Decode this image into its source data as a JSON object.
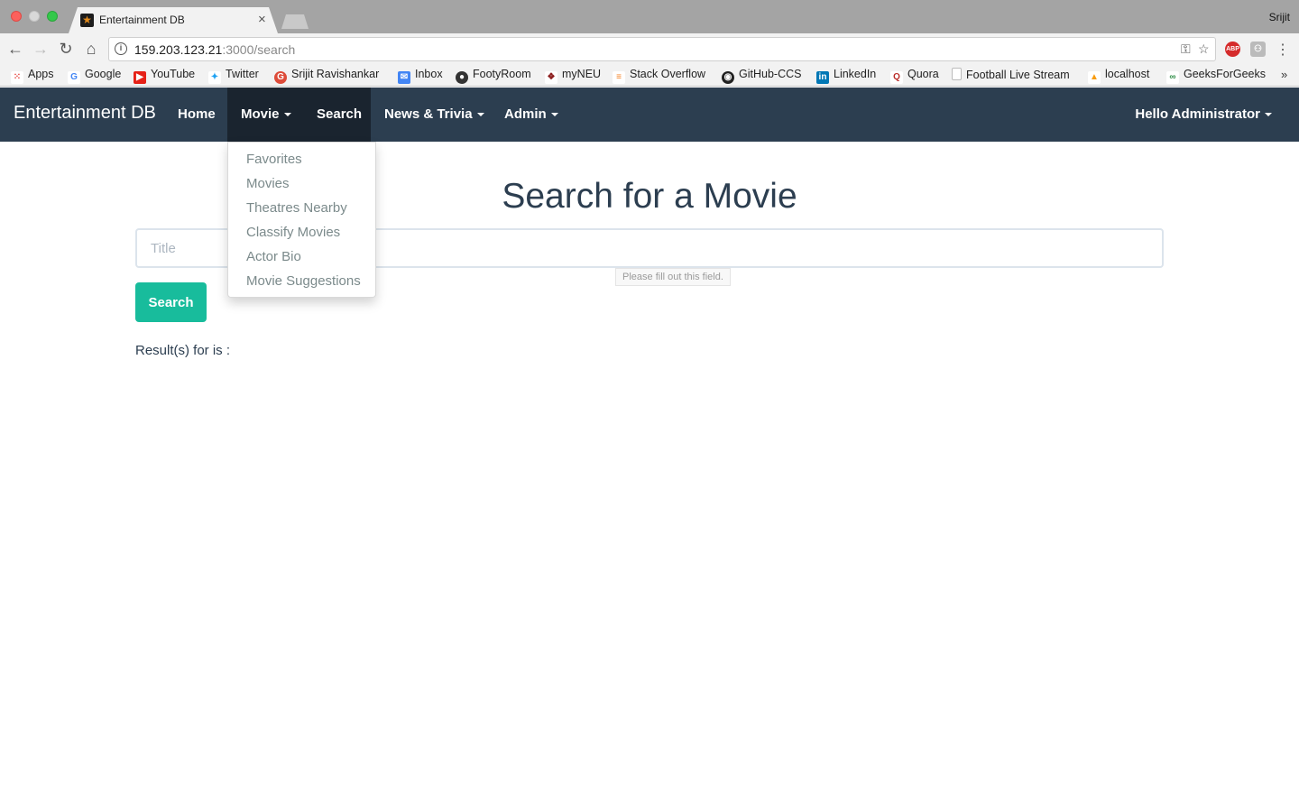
{
  "browser": {
    "tab_title": "Entertainment DB",
    "tab_close": "×",
    "profile": "Srijit",
    "url_host": "159.203.123.21",
    "url_path": ":3000/search",
    "ext_abp": "ABP",
    "bookmarks": [
      {
        "label": "Apps",
        "icon": "apps-icon",
        "color": "#e53935"
      },
      {
        "label": "Google",
        "icon": "google-icon",
        "color": "#4285f4"
      },
      {
        "label": "YouTube",
        "icon": "youtube-icon",
        "color": "#e62117"
      },
      {
        "label": "Twitter",
        "icon": "twitter-icon",
        "color": "#1da1f2"
      },
      {
        "label": "Srijit Ravishankar",
        "icon": "google-plus-icon",
        "color": "#dd4b39"
      },
      {
        "label": "Inbox",
        "icon": "inbox-icon",
        "color": "#4285f4"
      },
      {
        "label": "FootyRoom",
        "icon": "footyroom-icon",
        "color": "#333333"
      },
      {
        "label": "myNEU",
        "icon": "paw-icon",
        "color": "#8b1c1c"
      },
      {
        "label": "Stack Overflow",
        "icon": "stackoverflow-icon",
        "color": "#f48024"
      },
      {
        "label": "GitHub-CCS",
        "icon": "github-icon",
        "color": "#222222"
      },
      {
        "label": "LinkedIn",
        "icon": "linkedin-icon",
        "color": "#0077b5"
      },
      {
        "label": "Quora",
        "icon": "quora-icon",
        "color": "#b92b27"
      },
      {
        "label": "Football Live Stream",
        "icon": "page-icon",
        "color": "#aaaaaa"
      },
      {
        "label": "localhost",
        "icon": "pma-icon",
        "color": "#f89c0e"
      },
      {
        "label": "GeeksForGeeks",
        "icon": "geeksforgeeks-icon",
        "color": "#2f8d46"
      }
    ],
    "bookmarks_more": "»"
  },
  "navbar": {
    "brand": "Entertainment DB",
    "items": [
      "Home",
      "Movie",
      "Search",
      "News & Trivia",
      "Admin"
    ],
    "user": "Hello Administrator"
  },
  "dropdown": {
    "items": [
      "Favorites",
      "Movies",
      "Theatres Nearby",
      "Classify Movies",
      "Actor Bio",
      "Movie Suggestions"
    ]
  },
  "main": {
    "title": "Search for a Movie",
    "placeholder": "Title",
    "tooltip": "Please fill out this field.",
    "search_button": "Search",
    "results_text": "Result(s) for is :"
  },
  "colors": {
    "navbar": "#2c3e50",
    "navbar_active": "#1a242f",
    "accent": "#18bc9c"
  }
}
